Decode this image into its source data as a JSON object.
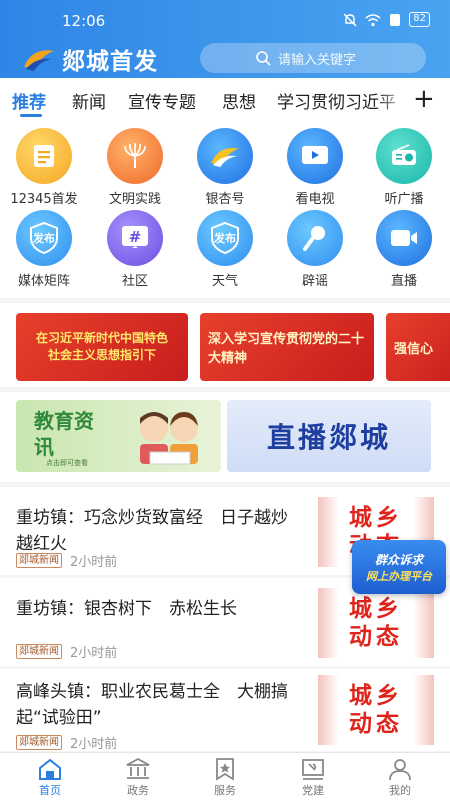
{
  "status": {
    "time": "12:06",
    "battery": "82"
  },
  "header": {
    "app_title": "郯城首发",
    "search_placeholder": "请输入关键字"
  },
  "tabs": [
    {
      "label": "推荐",
      "active": true
    },
    {
      "label": "新闻"
    },
    {
      "label": "宣传专题"
    },
    {
      "label": "思想"
    },
    {
      "label": "学习贯彻习近平"
    }
  ],
  "grid": [
    {
      "label": "12345首发",
      "icon": "document-icon"
    },
    {
      "label": "文明实践",
      "icon": "torch-icon"
    },
    {
      "label": "银杏号",
      "icon": "ginkgo-logo-icon"
    },
    {
      "label": "看电视",
      "icon": "tv-play-icon"
    },
    {
      "label": "听广播",
      "icon": "radio-icon"
    },
    {
      "label": "媒体矩阵",
      "icon": "publish-shield-icon",
      "badge": "发布"
    },
    {
      "label": "社区",
      "icon": "hashtag-icon"
    },
    {
      "label": "天气",
      "icon": "publish-shield-icon",
      "badge": "发布"
    },
    {
      "label": "辟谣",
      "icon": "microphone-icon"
    },
    {
      "label": "直播",
      "icon": "video-camera-icon"
    }
  ],
  "banners": [
    {
      "line1": "在习近平新时代中国特色",
      "line2": "社会主义思想指引下"
    },
    {
      "line1": "深入学习宣传贯彻党的二十大精神"
    },
    {
      "line1": "强信心"
    }
  ],
  "promos": {
    "edu_title": "教育资讯",
    "edu_small": "点击即可查看",
    "live_title": "直播郯城"
  },
  "news": [
    {
      "title": "重坊镇：巧念炒货致富经　日子越炒越红火",
      "tag": "郯城新闻",
      "time": "2小时前",
      "thumb_l1": "城乡",
      "thumb_l2": "动态"
    },
    {
      "title": "重坊镇：银杏树下　赤松生长",
      "tag": "郯城新闻",
      "time": "2小时前",
      "thumb_l1": "城乡",
      "thumb_l2": "动态"
    },
    {
      "title": "高峰头镇：职业农民葛士全　大棚搞起“试验田”",
      "tag": "郯城新闻",
      "time": "2小时前",
      "thumb_l1": "城乡",
      "thumb_l2": "动态"
    }
  ],
  "float_button": {
    "line1": "群众诉求",
    "line2": "网上办理平台"
  },
  "bottom_nav": [
    {
      "label": "首页",
      "active": true
    },
    {
      "label": "政务"
    },
    {
      "label": "服务"
    },
    {
      "label": "党建"
    },
    {
      "label": "我的"
    }
  ],
  "colors": {
    "accent": "#2b7fe0",
    "header": "#3a93ea",
    "news_red": "#e0231b"
  }
}
